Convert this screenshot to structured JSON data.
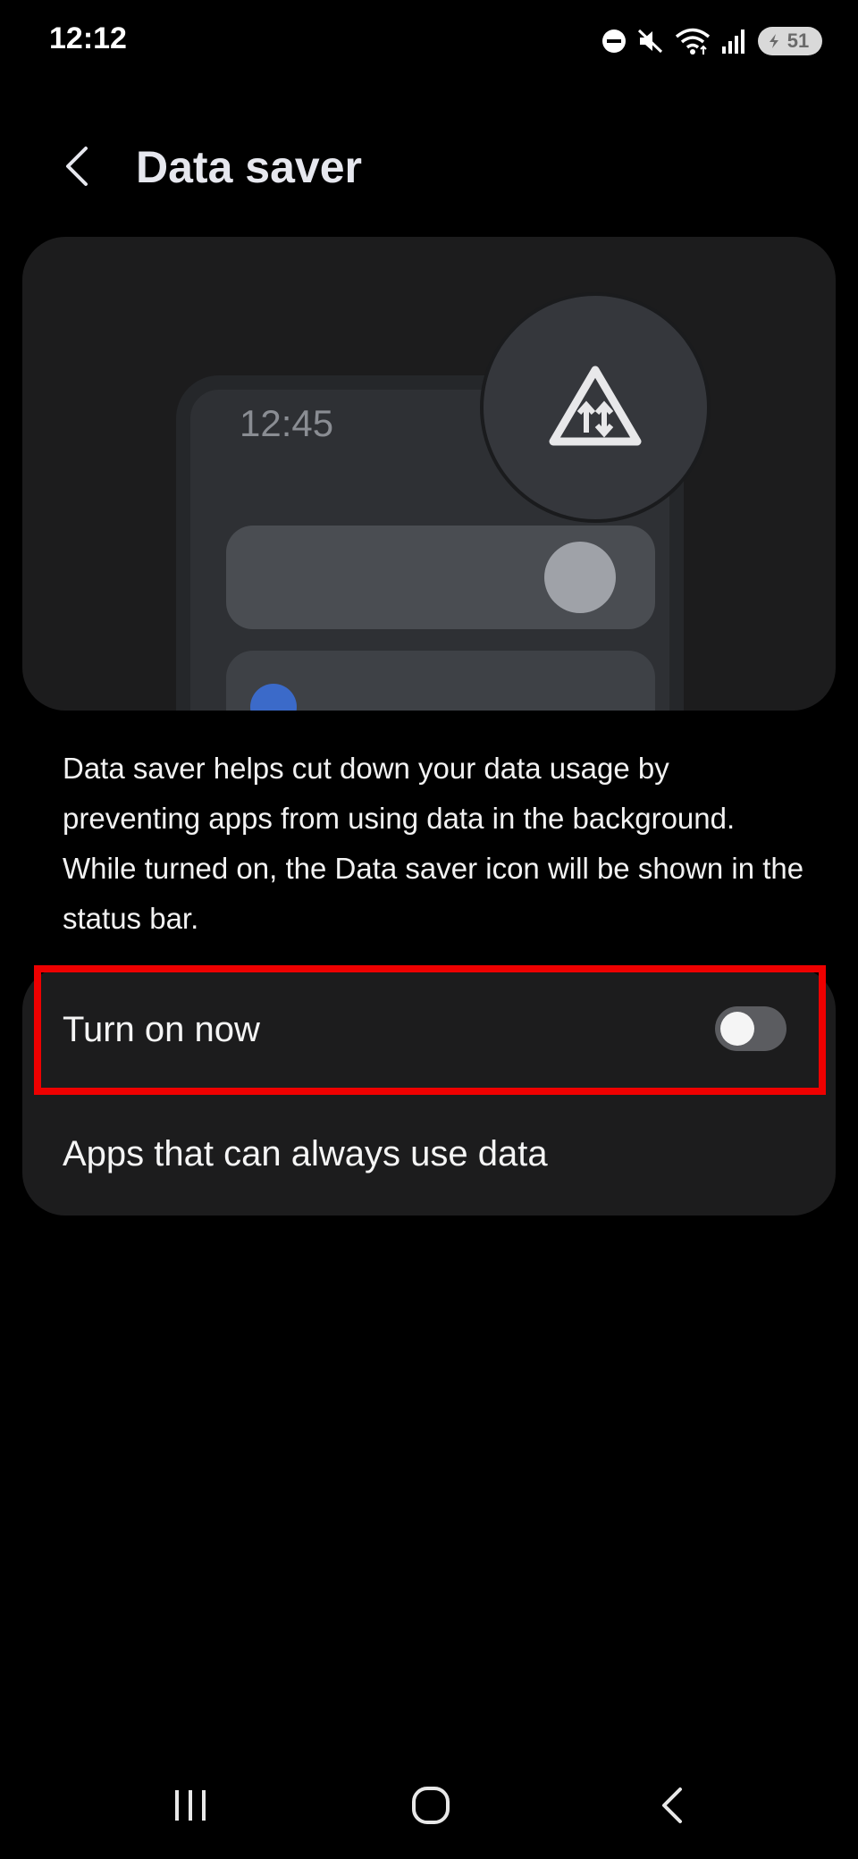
{
  "status_bar": {
    "time": "12:12",
    "battery_level": "51",
    "icons": [
      "do-not-disturb-icon",
      "mute-icon",
      "wifi-icon",
      "signal-icon",
      "battery-icon"
    ]
  },
  "header": {
    "title": "Data saver",
    "back_icon": "chevron-left-icon"
  },
  "illustration": {
    "phone_time": "12:45",
    "icon": "data-saver-icon"
  },
  "description": "Data saver helps cut down your data usage by preventing apps from using data in the background. While turned on, the Data saver icon will be shown in the status bar.",
  "settings": {
    "turn_on": {
      "label": "Turn on now",
      "enabled": false
    },
    "apps": {
      "label": "Apps that can always use data"
    }
  },
  "highlight_color": "#ee0000",
  "nav_bar": {
    "icons": [
      "recent-apps-icon",
      "home-icon",
      "back-icon"
    ]
  }
}
